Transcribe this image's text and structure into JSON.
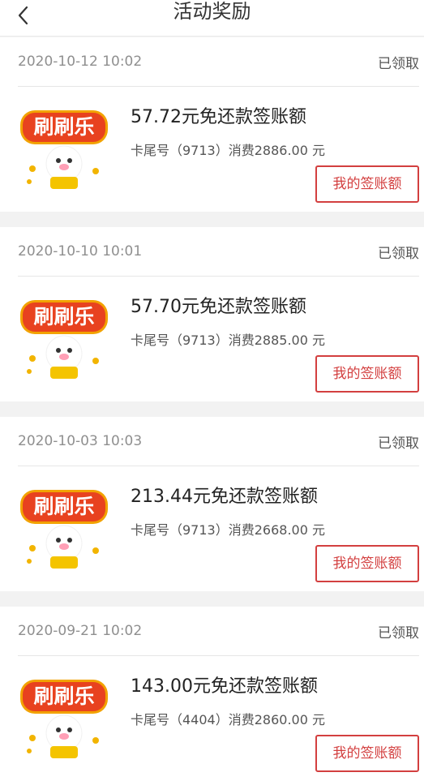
{
  "header": {
    "title": "活动奖励"
  },
  "colors": {
    "accent": "#d33f3f"
  },
  "items": [
    {
      "datetime": "2020-10-12 10:02",
      "status": "已领取",
      "badge_text": "刷刷乐",
      "reward": "57.72元免还款签账额",
      "detail": "卡尾号（9713）消费2886.00 元",
      "button_label": "我的签账额"
    },
    {
      "datetime": "2020-10-10 10:01",
      "status": "已领取",
      "badge_text": "刷刷乐",
      "reward": "57.70元免还款签账额",
      "detail": "卡尾号（9713）消费2885.00 元",
      "button_label": "我的签账额"
    },
    {
      "datetime": "2020-10-03 10:03",
      "status": "已领取",
      "badge_text": "刷刷乐",
      "reward": "213.44元免还款签账额",
      "detail": "卡尾号（9713）消费2668.00 元",
      "button_label": "我的签账额"
    },
    {
      "datetime": "2020-09-21 10:02",
      "status": "已领取",
      "badge_text": "刷刷乐",
      "reward": "143.00元免还款签账额",
      "detail": "卡尾号（4404）消费2860.00 元",
      "button_label": "我的签账额"
    }
  ]
}
